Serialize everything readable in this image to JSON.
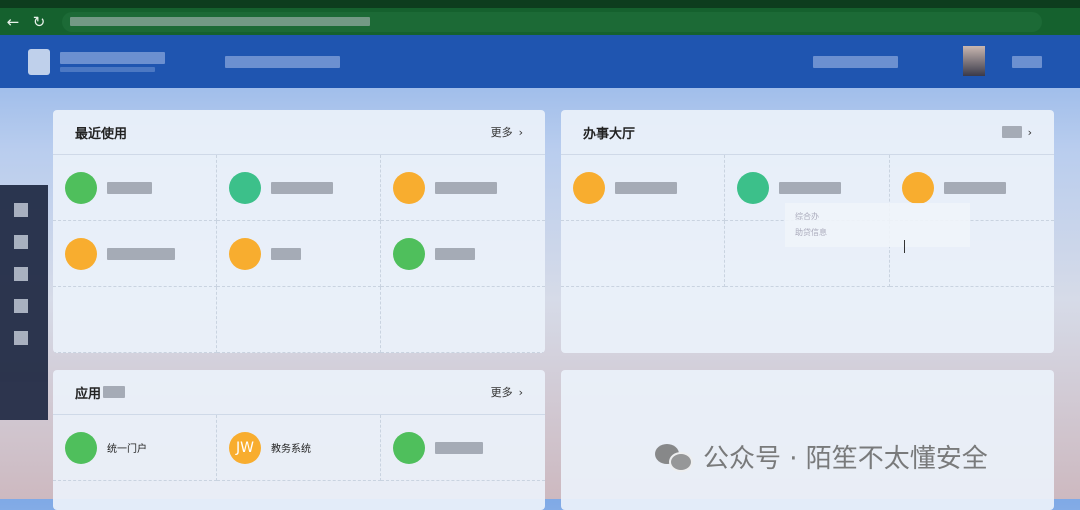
{
  "browser": {
    "back_icon": "←",
    "reload_icon": "↻"
  },
  "cards": {
    "recent": {
      "title": "最近使用",
      "more": "更多"
    },
    "hall": {
      "title": "办事大厅",
      "more_icon": "›"
    },
    "apps": {
      "title": "应用",
      "more": "更多",
      "items": [
        {
          "icon_text": "",
          "label": "统一门户"
        },
        {
          "icon_text": "JW",
          "label": "教务系统"
        }
      ]
    }
  },
  "tooltip": {
    "line1": "综合办",
    "line2": "助贷信息"
  },
  "watermark": "公众号 · 陌笙不太懂安全",
  "chevron": "›"
}
